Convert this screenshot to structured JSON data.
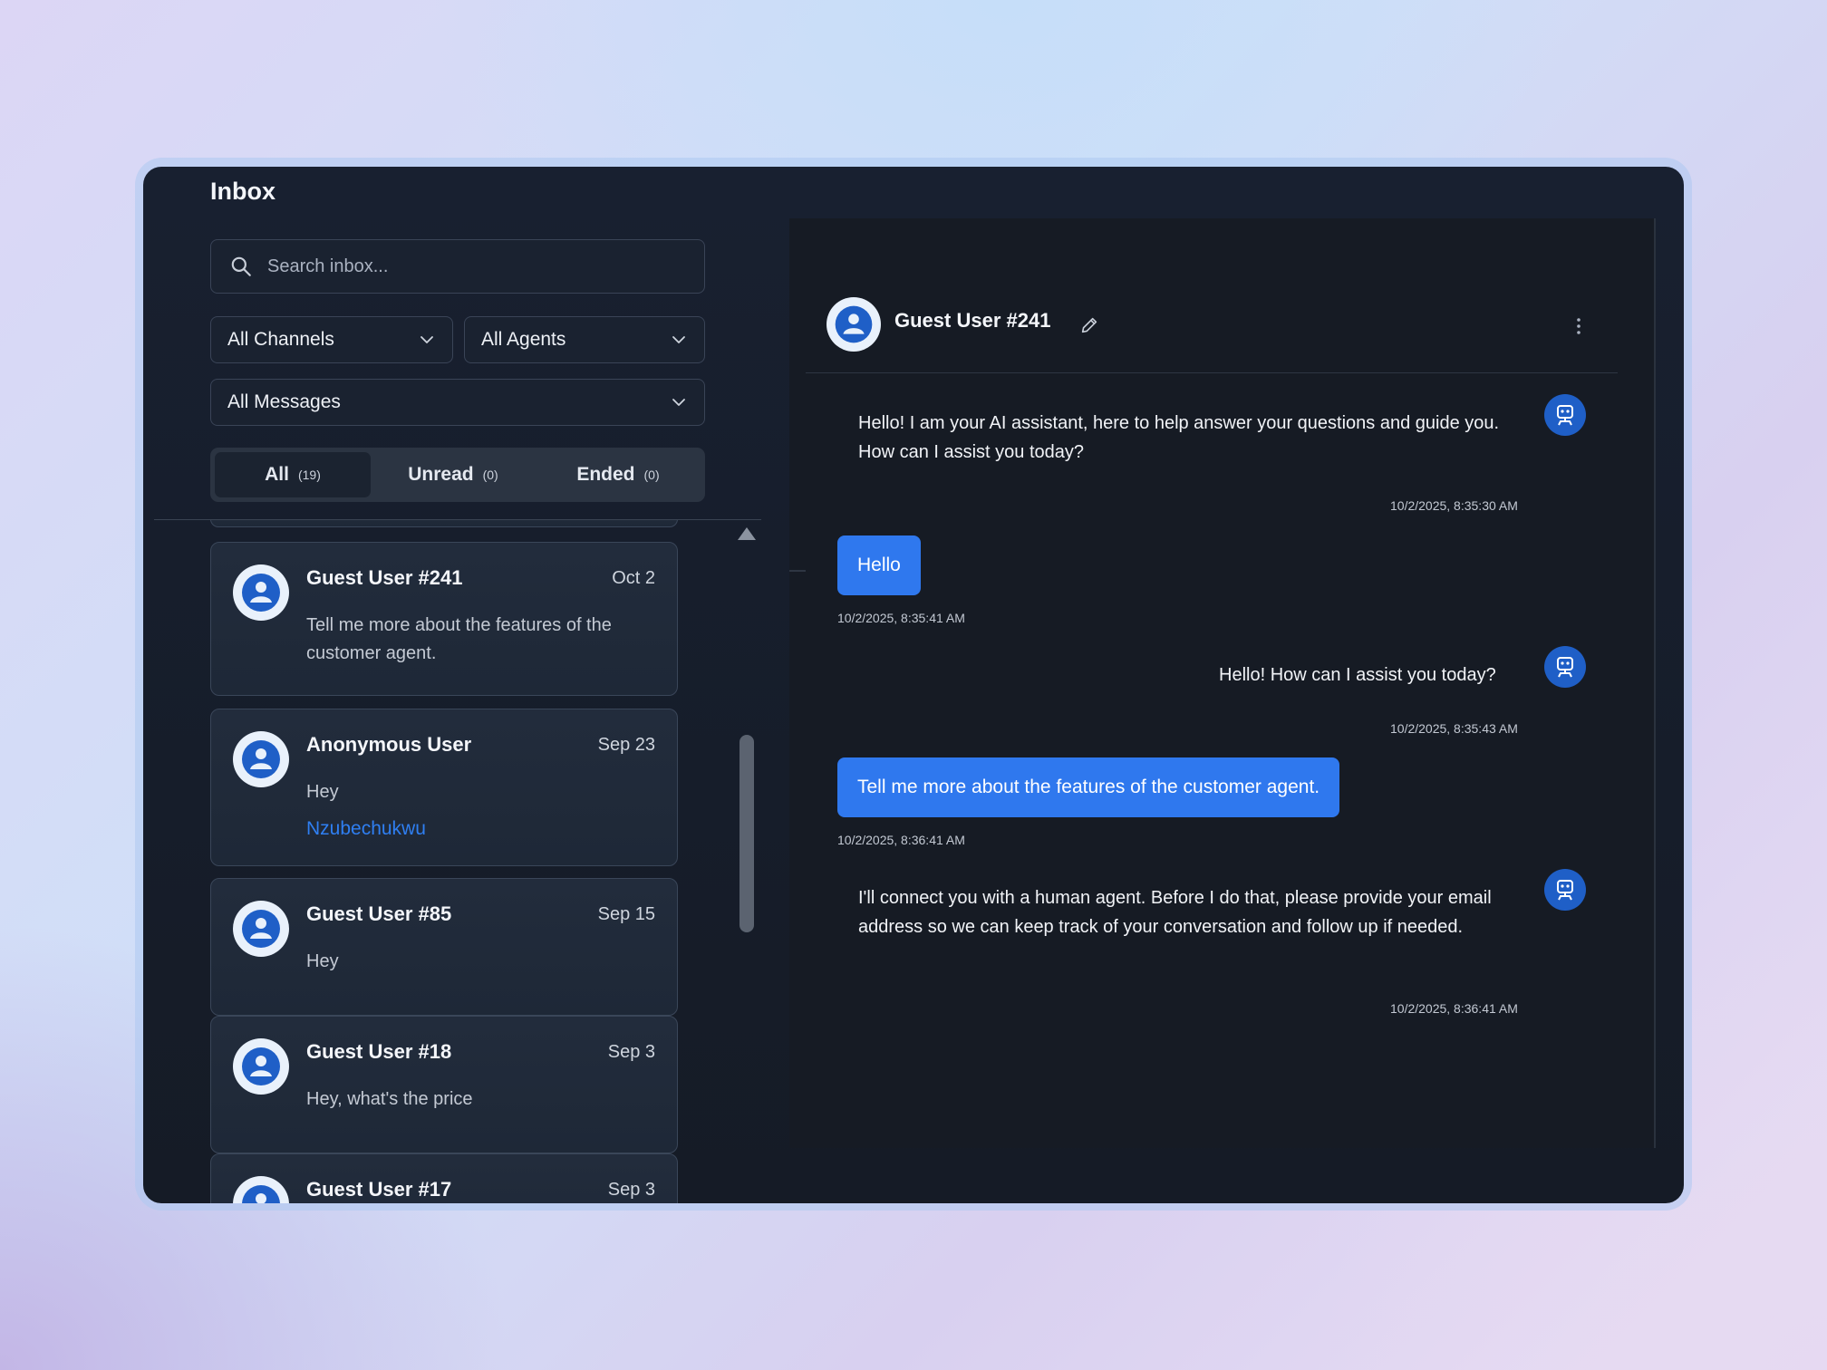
{
  "inbox": {
    "title": "Inbox",
    "search_placeholder": "Search inbox...",
    "filters": {
      "channels": "All Channels",
      "agents": "All Agents",
      "messages": "All Messages"
    },
    "tabs": [
      {
        "label": "All",
        "count": "(19)"
      },
      {
        "label": "Unread",
        "count": "(0)"
      },
      {
        "label": "Ended",
        "count": "(0)"
      }
    ],
    "conversations": [
      {
        "name": "Guest User #241",
        "date": "Oct 2",
        "preview": "Tell me more about the features of the customer agent."
      },
      {
        "name": "Anonymous User",
        "date": "Sep 23",
        "preview": "Hey",
        "agent": "Nzubechukwu"
      },
      {
        "name": "Guest User #85",
        "date": "Sep 15",
        "preview": "Hey"
      },
      {
        "name": "Guest User #18",
        "date": "Sep 3",
        "preview": "Hey, what's the price"
      },
      {
        "name": "Guest User #17",
        "date": "Sep 3"
      }
    ]
  },
  "chat": {
    "title": "Guest User #241",
    "messages": [
      {
        "from": "bot",
        "text": "Hello! I am your AI assistant, here to help answer your questions and guide you. How can I assist you today?",
        "time": "10/2/2025, 8:35:30 AM"
      },
      {
        "from": "user",
        "text": "Hello",
        "time": "10/2/2025, 8:35:41 AM"
      },
      {
        "from": "bot",
        "text": "Hello! How can I assist you today?",
        "time": "10/2/2025, 8:35:43 AM"
      },
      {
        "from": "user",
        "text": "Tell me more about the features of the customer agent.",
        "time": "10/2/2025, 8:36:41 AM"
      },
      {
        "from": "bot",
        "text": "I'll connect you with a human agent. Before I do that, please provide your email address so we can keep track of your conversation and follow up if needed.",
        "time": "10/2/2025, 8:36:41 AM"
      }
    ]
  },
  "colors": {
    "accent": "#2f78ee",
    "agent_link": "#2f7ff2",
    "panel_bg": "#151b26",
    "avatar_blue": "#1f5fc7"
  },
  "icons": [
    "search-icon",
    "chevron-down-icon",
    "user-avatar-icon",
    "pencil-icon",
    "kebab-menu-icon",
    "bot-icon",
    "scroll-up-icon"
  ]
}
